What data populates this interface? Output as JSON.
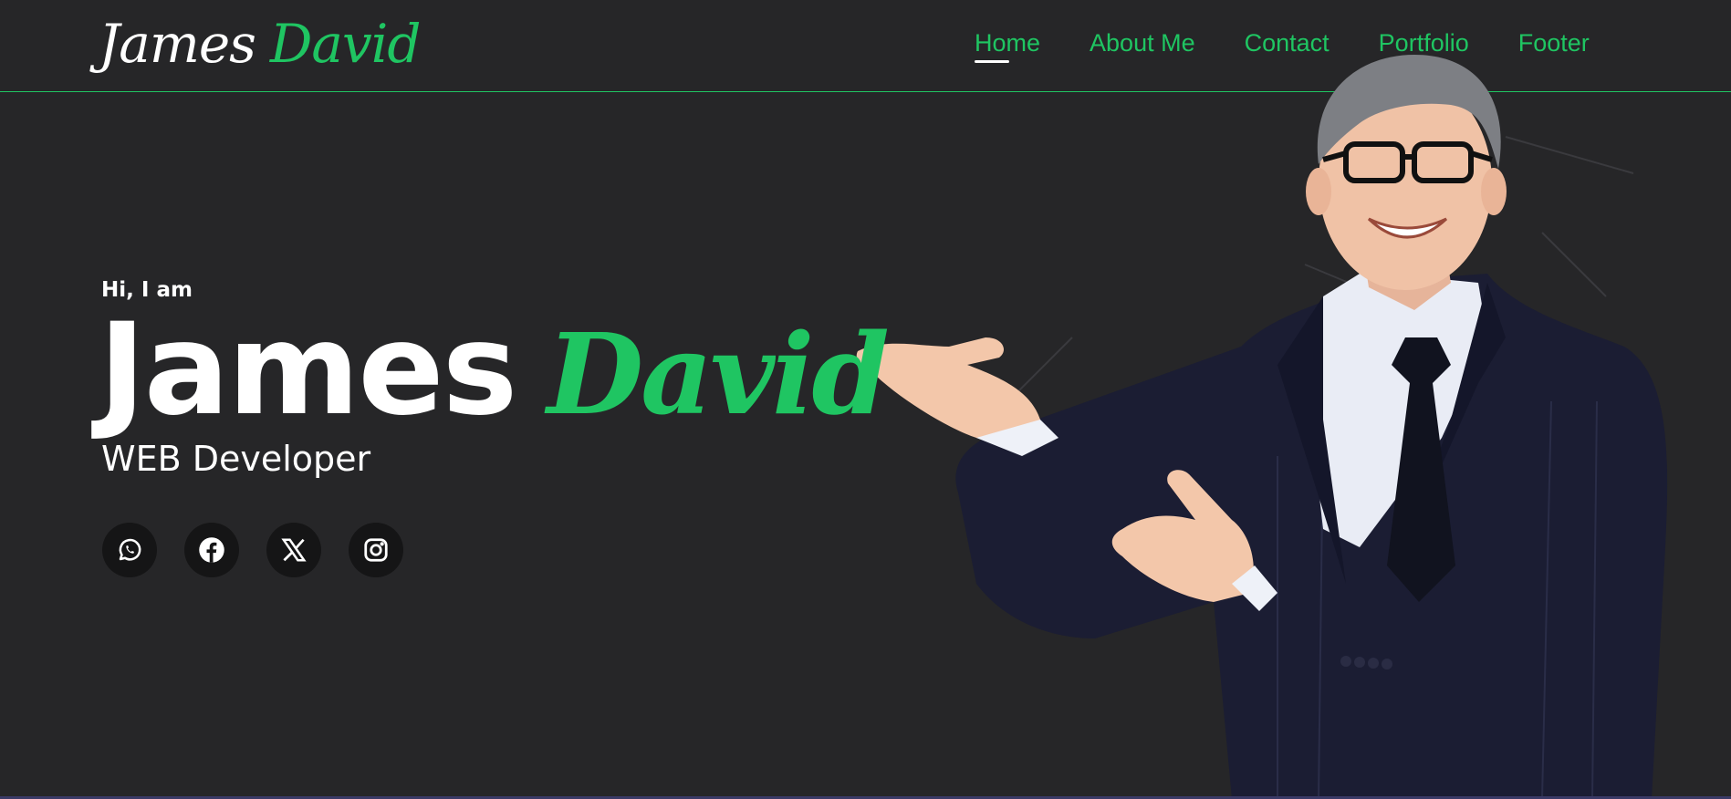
{
  "header": {
    "logo_first": "James",
    "logo_last": "David",
    "nav": [
      {
        "label": "Home",
        "active": true
      },
      {
        "label": "About Me",
        "active": false
      },
      {
        "label": "Contact",
        "active": false
      },
      {
        "label": "Portfolio",
        "active": false
      },
      {
        "label": "Footer",
        "active": false
      }
    ]
  },
  "hero": {
    "greeting": "Hi, I am",
    "first_name": "James",
    "last_name": "David",
    "role": "WEB Developer"
  },
  "socials": [
    {
      "icon": "whatsapp-icon"
    },
    {
      "icon": "facebook-icon"
    },
    {
      "icon": "x-twitter-icon"
    },
    {
      "icon": "instagram-icon"
    }
  ],
  "colors": {
    "background": "#262628",
    "accent": "#1fc562",
    "text": "#ffffff",
    "social_bg": "#151516"
  }
}
